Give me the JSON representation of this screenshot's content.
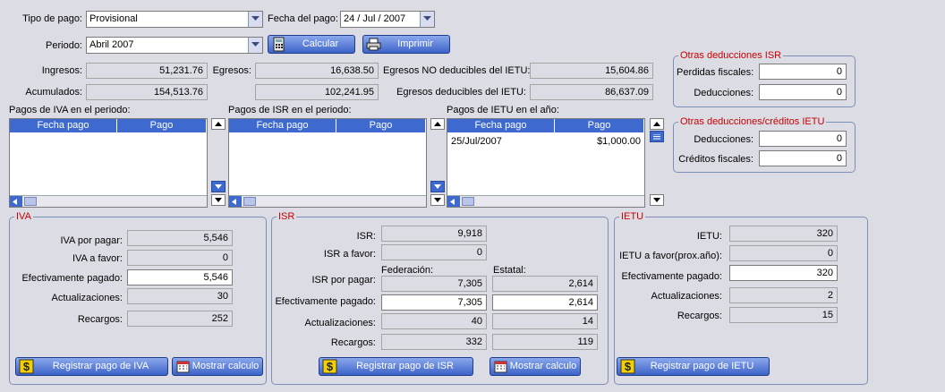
{
  "top": {
    "tipo_pago_label": "Tipo de pago:",
    "tipo_pago_value": "Provisional",
    "fecha_pago_label": "Fecha del pago:",
    "fecha_pago_value": "24 /  Jul  / 2007",
    "periodo_label": "Periodo:",
    "periodo_value": "Abril 2007",
    "calcular_label": "Calcular",
    "imprimir_label": "Imprimir"
  },
  "summary": {
    "ingresos_label": "Ingresos:",
    "ingresos": "51,231.76",
    "acumulados_label": "Acumulados:",
    "acumulados": "154,513.76",
    "egresos_label": "Egresos:",
    "egresos": "16,638.50",
    "egresos_acum": "102,241.95",
    "no_deducibles_label": "Egresos NO deducibles del IETU:",
    "no_deducibles": "15,604.86",
    "deducibles_label": "Egresos deducibles del IETU:",
    "deducibles": "86,637.09"
  },
  "otras_isr": {
    "title": "Otras deducciones ISR",
    "perdidas_label": "Perdidas fiscales:",
    "perdidas": "0",
    "deducciones_label": "Deducciones:",
    "deducciones": "0"
  },
  "otras_ietu": {
    "title": "Otras deducciones/créditos IETU",
    "deducciones_label": "Deducciones:",
    "deducciones": "0",
    "creditos_label": "Créditos fiscales:",
    "creditos": "0"
  },
  "lists": {
    "iva_title": "Pagos de IVA en el periodo:",
    "isr_title": "Pagos de ISR en el periodo:",
    "ietu_title": "Pagos de IETU en el año:",
    "col_fecha": "Fecha pago",
    "col_pago": "Pago",
    "ietu_rows": [
      {
        "fecha": "25/Jul/2007",
        "pago": "$1,000.00"
      }
    ]
  },
  "iva": {
    "title": "IVA",
    "por_pagar_label": "IVA por pagar:",
    "por_pagar": "5,546",
    "a_favor_label": "IVA a favor:",
    "a_favor": "0",
    "efectivamente_label": "Efectivamente pagado:",
    "efectivamente": "5,546",
    "actualizaciones_label": "Actualizaciones:",
    "actualizaciones": "30",
    "recargos_label": "Recargos:",
    "recargos": "252",
    "registrar_label": "Registrar pago de IVA",
    "mostrar_label": "Mostrar calculo"
  },
  "isr": {
    "title": "ISR",
    "isr_label": "ISR:",
    "isr": "9,918",
    "a_favor_label": "ISR a favor:",
    "a_favor": "0",
    "federacion_label": "Federación:",
    "estatal_label": "Estatal:",
    "por_pagar_label": "ISR por pagar:",
    "por_pagar_fed": "7,305",
    "por_pagar_est": "2,614",
    "efectivamente_label": "Efectivamente pagado:",
    "efectivamente_fed": "7,305",
    "efectivamente_est": "2,614",
    "actualizaciones_label": "Actualizaciones:",
    "actualizaciones_fed": "40",
    "actualizaciones_est": "14",
    "recargos_label": "Recargos:",
    "recargos_fed": "332",
    "recargos_est": "119",
    "registrar_label": "Registrar pago de ISR",
    "mostrar_label": "Mostrar calculo"
  },
  "ietu": {
    "title": "IETU",
    "ietu_label": "IETU:",
    "ietu": "320",
    "a_favor_label": "IETU a favor(prox.año):",
    "a_favor": "0",
    "efectivamente_label": "Efectivamente pagado:",
    "efectivamente": "320",
    "actualizaciones_label": "Actualizaciones:",
    "actualizaciones": "2",
    "recargos_label": "Recargos:",
    "recargos": "15",
    "registrar_label": "Registrar pago de IETU"
  }
}
